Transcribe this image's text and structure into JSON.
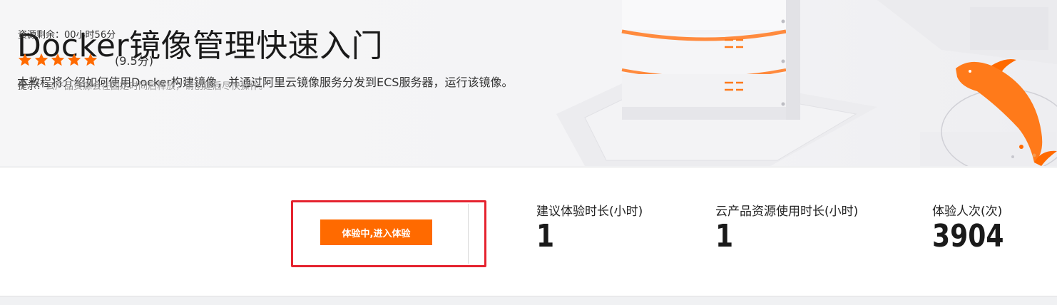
{
  "banner": {
    "title": "Docker镜像管理快速入门",
    "description": "本教程将介绍如何使用Docker构建镜像，并通过阿里云镜像服务分发到ECS服务器，运行该镜像。"
  },
  "card": {
    "resource_remaining": "资源剩余：00小时56分",
    "rating": {
      "stars": 5,
      "score": "(9.5分)"
    },
    "tip_label": "提示：",
    "tip_text": "云产品资源会在固定时间后释放，请创建后尽快操作。",
    "enter_button": "体验中,进入体验"
  },
  "stats": [
    {
      "label": "建议体验时长(小时)",
      "value": "1"
    },
    {
      "label": "云产品资源使用时长(小时)",
      "value": "1"
    },
    {
      "label": "体验人次(次)",
      "value": "3904"
    }
  ],
  "colors": {
    "accent": "#ff6a00",
    "highlight_border": "#e5232f",
    "star": "#ff6a00"
  },
  "icons": [
    "star-icon",
    "server-illustration",
    "dolphin-illustration"
  ]
}
